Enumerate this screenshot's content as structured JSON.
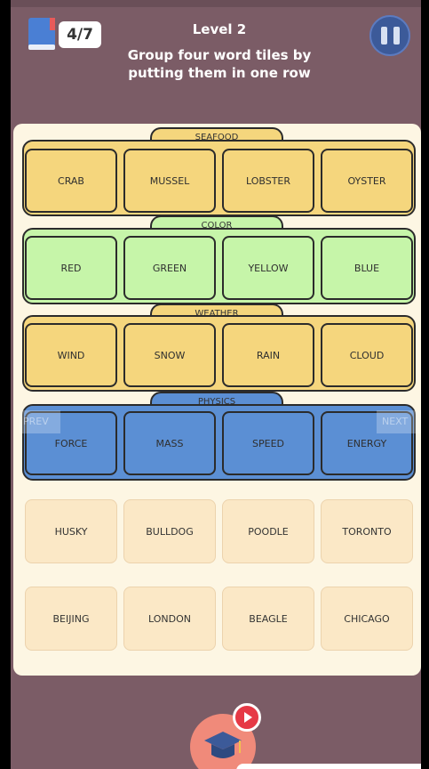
{
  "header": {
    "progress": "4/7",
    "title": "Level 2",
    "instruction_line1": "Group four word tiles by",
    "instruction_line2": "putting them in one row"
  },
  "icons": {
    "book": "book-icon",
    "pause": "pause-icon",
    "hint": "graduation-cap-icon",
    "video": "play-icon"
  },
  "colors": {
    "background": "#7b5c66",
    "board": "#fdf6e3",
    "seafood": "#f5d67d",
    "color": "#c6f5a9",
    "weather": "#f5d67d",
    "physics": "#5b8fd4",
    "free_tile": "#fbe8c6"
  },
  "groups": [
    {
      "label": "SEAFOOD",
      "tiles": [
        "CRAB",
        "MUSSEL",
        "LOBSTER",
        "OYSTER"
      ]
    },
    {
      "label": "COLOR",
      "tiles": [
        "RED",
        "GREEN",
        "YELLOW",
        "BLUE"
      ]
    },
    {
      "label": "WEATHER",
      "tiles": [
        "WIND",
        "SNOW",
        "RAIN",
        "CLOUD"
      ]
    },
    {
      "label": "PHYSICS",
      "tiles": [
        "FORCE",
        "MASS",
        "SPEED",
        "ENERGY"
      ]
    }
  ],
  "remaining_tiles": [
    [
      "HUSKY",
      "BULLDOG",
      "POODLE",
      "TORONTO"
    ],
    [
      "BEIJING",
      "LONDON",
      "BEAGLE",
      "CHICAGO"
    ]
  ],
  "nav": {
    "prev": "PREV",
    "next": "NEXT"
  }
}
